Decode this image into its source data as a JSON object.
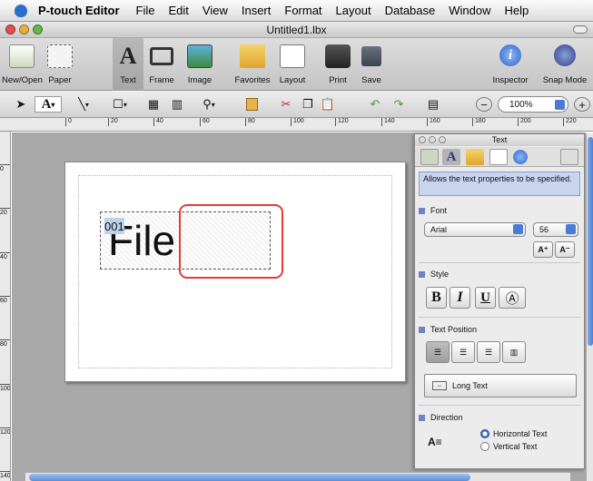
{
  "menubar": {
    "app": "P-touch Editor",
    "items": [
      "File",
      "Edit",
      "View",
      "Insert",
      "Format",
      "Layout",
      "Database",
      "Window",
      "Help"
    ]
  },
  "window": {
    "title": "Untitled1.lbx"
  },
  "toolbar": {
    "new_open": "New/Open",
    "paper": "Paper",
    "text": "Text",
    "frame": "Frame",
    "image": "Image",
    "favorites": "Favorites",
    "layout": "Layout",
    "print": "Print",
    "save": "Save",
    "inspector": "Inspector",
    "snap_mode": "Snap Mode"
  },
  "toolbar2": {
    "zoom": "100%",
    "zoom_out": "−",
    "zoom_in": "+"
  },
  "ruler": {
    "h_ticks": [
      "0",
      "20",
      "40",
      "60",
      "80",
      "100",
      "120",
      "140",
      "160",
      "180",
      "200",
      "220"
    ],
    "v_ticks": [
      "0",
      "20",
      "40",
      "60",
      "80",
      "100",
      "120",
      "140"
    ]
  },
  "canvas": {
    "text_part1": "File",
    "text_part2": "001"
  },
  "panel": {
    "title": "Text",
    "description": "Allows the text properties to be specified.",
    "font": {
      "label": "Font",
      "family": "Arial",
      "size": "56"
    },
    "style": {
      "label": "Style",
      "bold": "B",
      "italic": "I",
      "underline": "U"
    },
    "text_position": {
      "label": "Text Position",
      "long_text": "Long Text"
    },
    "direction": {
      "label": "Direction",
      "horizontal": "Horizontal Text",
      "vertical": "Vertical Text",
      "selected": "Horizontal Text"
    }
  },
  "colors": {
    "accent_blue": "#4a7bd6",
    "selection_red": "#e43a3a",
    "workspace": "#a8a8a8"
  }
}
